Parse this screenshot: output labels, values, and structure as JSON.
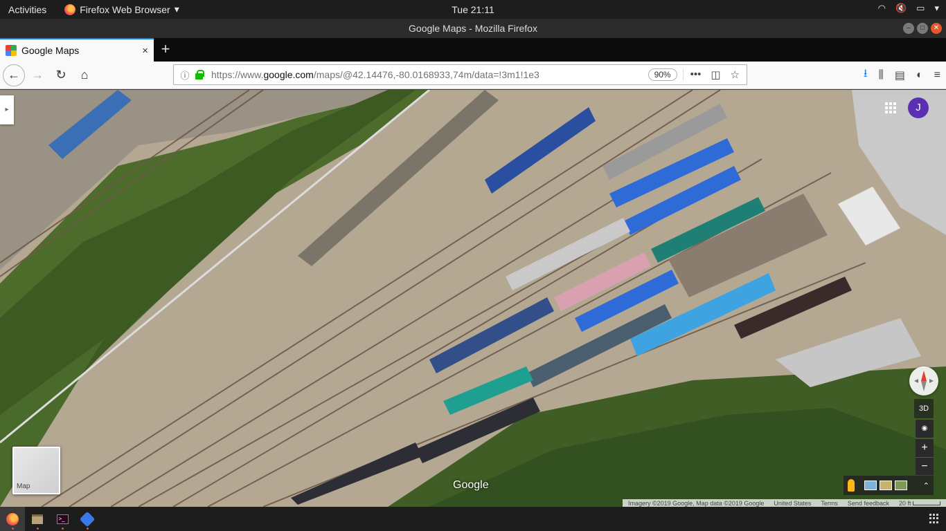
{
  "system": {
    "activities": "Activities",
    "app_menu": "Firefox Web Browser",
    "clock": "Tue 21:11"
  },
  "window": {
    "title": "Google Maps - Mozilla Firefox"
  },
  "tab": {
    "title": "Google Maps",
    "close": "×",
    "new_tab": "+"
  },
  "navbar": {
    "url_scheme_prefix": "https://www.",
    "url_host": "google.com",
    "url_path": "/maps/@42.14476,-80.0168933,74m/data=!3m1!1e3",
    "zoom": "90%"
  },
  "map": {
    "account_initial": "J",
    "map_toggle_label": "Map",
    "logo": "Google",
    "btn_3d": "3D",
    "zoom_in": "+",
    "zoom_out": "−",
    "imagery_chevron": "⌃",
    "attribution": {
      "imagery": "Imagery ©2019 Google, Map data ©2019 Google",
      "country": "United States",
      "terms": "Terms",
      "feedback": "Send feedback",
      "scale": "20 ft"
    }
  },
  "colors": {
    "firefox_accent": "#0a84ff",
    "secure_lock": "#12bc00",
    "avatar": "#5b2fb4",
    "ubuntu_orange": "#e95420"
  },
  "icons": {
    "tray": [
      "wifi-icon",
      "volume-muted-icon",
      "battery-icon",
      "system-menu-icon"
    ],
    "dock": [
      "firefox-icon",
      "files-icon",
      "terminal-icon",
      "network-icon"
    ]
  }
}
